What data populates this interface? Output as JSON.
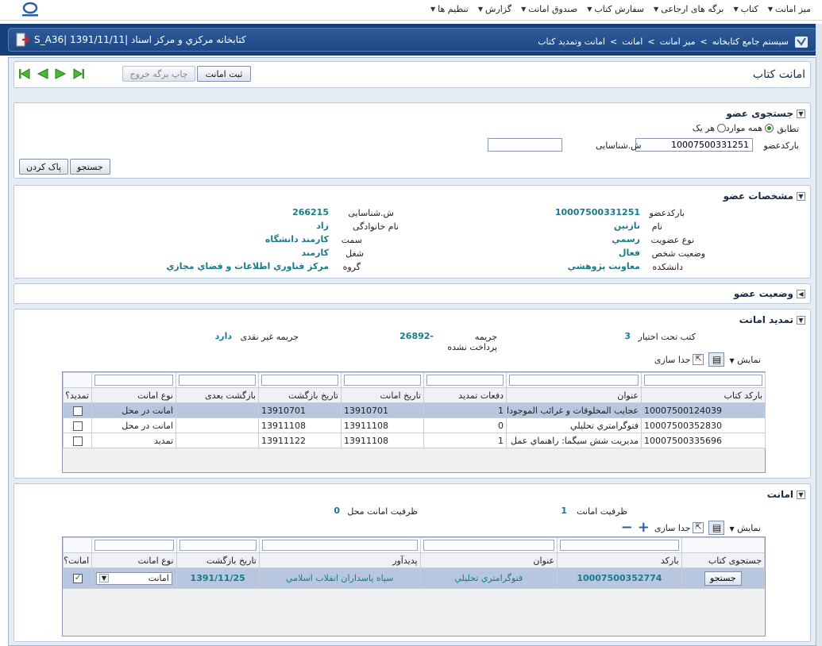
{
  "topmenu": {
    "items": [
      "میز امانت",
      "کتاب",
      "برگه های ارجاعی",
      "سفارش کتاب",
      "صندوق امانت",
      "گزارش",
      "تنظیم ها"
    ]
  },
  "header": {
    "crumb_system": "سیستم جامع کتابخانه",
    "crumb_desk": "میز امانت",
    "crumb_loan": "امانت",
    "crumb_page": "امانت وتمدید کتاب",
    "sep": ">",
    "left_info": "S_A36| کتابخانه مرکزي و مرکز اسناد |1391/11/11"
  },
  "page": {
    "title": "امانت کتاب",
    "register_btn": "ثبت امانت",
    "print_btn": "چاپ برگه خروج"
  },
  "search": {
    "title": "جستجوی عضو",
    "match_label": "تطابق",
    "opt_all": "همه موارد",
    "opt_any": "هر یک",
    "barcode_label": "بارکدعضو",
    "barcode_value": "10007500331251",
    "id_label": "ش.شناسایی",
    "id_value": "",
    "search_btn": "جستجو",
    "clear_btn": "پاک کردن"
  },
  "member": {
    "title": "مشخصات عضو",
    "barcode_label": "بارکدعضو",
    "barcode": "10007500331251",
    "name_label": "نام",
    "name": "نازنين",
    "type_label": "نوع عضویت",
    "type": "رسمي",
    "status_label": "وضعیت شخص",
    "status": "فعال",
    "faculty_label": "دانشکده",
    "faculty": "معاونت پژوهشي",
    "idno_label": "ش.شناسایی",
    "idno": "266215",
    "family_label": "نام خانوادگی",
    "family": "زاد",
    "post_label": "سمت",
    "post": "کارمند دانشگاه",
    "job_label": "شغل",
    "job": "کارمند",
    "group_label": "گروه",
    "group": "مرکز فناوري اطلاعات و فضاي مجازي"
  },
  "member_status": {
    "title": "وضعیت عضو"
  },
  "renew": {
    "title": "تمدید امانت",
    "books_label": "کتب تحت اختیار",
    "books": "3",
    "fine_label": "جریمه پرداخت نشده",
    "fine": "-26892",
    "nonfine_label": "جریمه غیر نقدی",
    "nonfine": "دارد",
    "view_label": "نمایش",
    "detach_label": "جدا سازی",
    "columns": [
      "بارکد کتاب",
      "عنوان",
      "دفعات تمدید",
      "تاریخ امانت",
      "تاریخ بازگشت",
      "بازگشت بعدی",
      "نوع امانت",
      "تمدید؟"
    ],
    "rows": [
      {
        "barcode": "10007500124039",
        "title": "عجايب المخلوقات و غرائب الموجودات",
        "times": "1",
        "loan": "13910701",
        "ret": "13910701",
        "next": "",
        "kind": "امانت در محل",
        "renew": false
      },
      {
        "barcode": "10007500352830",
        "title": "فتوگرامتري تحليلي",
        "times": "0",
        "loan": "13911108",
        "ret": "13911108",
        "next": "",
        "kind": "امانت در محل",
        "renew": false
      },
      {
        "barcode": "10007500335696",
        "title": "مديريت شش سيگما: راهنماي عمل",
        "times": "1",
        "loan": "13911108",
        "ret": "13911122",
        "next": "",
        "kind": "تمديد",
        "renew": false
      }
    ]
  },
  "loan": {
    "title": "امانت",
    "capacity_label": "ظرفیت امانت",
    "capacity": "1",
    "local_label": "ظرفیت امانت محل",
    "local": "0",
    "view_label": "نمایش",
    "detach_label": "جدا سازی",
    "columns": [
      "جستجوی کتاب",
      "بارکد",
      "عنوان",
      "پدیدآور",
      "تاریخ بازگشت",
      "نوع امانت",
      "امانت؟"
    ],
    "row": {
      "search_btn": "جستجو",
      "barcode": "10007500352774",
      "title": "فتوگرامتري تحليلي",
      "author": "سپاه پاسداران انقلاب اسلامي",
      "ret": "1391/11/25",
      "kind": "امانت",
      "checked": true
    }
  }
}
